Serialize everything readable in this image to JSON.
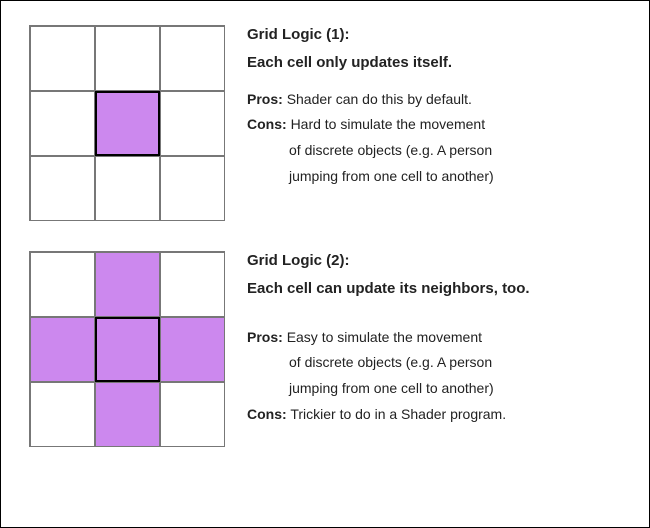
{
  "accent": "#cc88ee",
  "sections": [
    {
      "title": "Grid Logic (1):",
      "subtitle": "Each cell only updates itself.",
      "pros_label": "Pros:",
      "pros_text": "Shader can do this by default.",
      "cons_label": "Cons:",
      "cons_text": "Hard to simulate the movement",
      "cons_text_l2": "of discrete objects (e.g. A person",
      "cons_text_l3": "jumping from one cell to another)",
      "highlight_pattern": "center"
    },
    {
      "title": "Grid Logic (2):",
      "subtitle": "Each cell can update its neighbors, too.",
      "pros_label": "Pros:",
      "pros_text": "Easy to simulate the movement",
      "pros_text_l2": "of discrete objects (e.g. A person",
      "pros_text_l3": "jumping from one cell to another)",
      "cons_label": "Cons:",
      "cons_text": "Trickier to do in a Shader program.",
      "highlight_pattern": "plus"
    }
  ]
}
